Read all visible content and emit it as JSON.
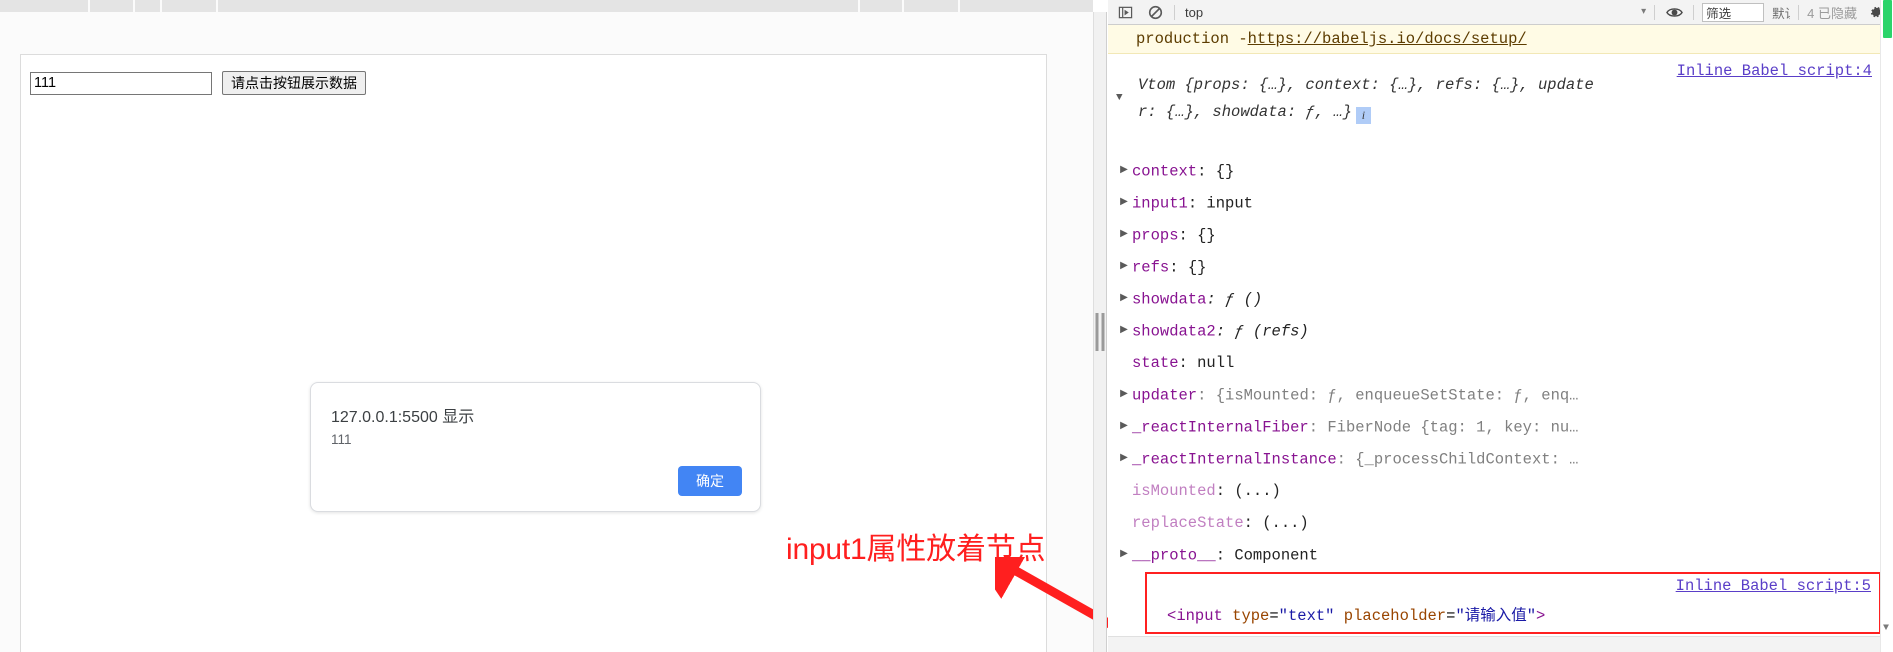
{
  "page": {
    "input": {
      "value": "111",
      "placeholder": "请输入值"
    },
    "show_data_button": "请点击按钮展示数据"
  },
  "dialog": {
    "origin": "127.0.0.1:5500 显示",
    "message": "111",
    "ok_button": "确定"
  },
  "annotation": {
    "text": "input1属性放着节点",
    "color": "#ff1f1f"
  },
  "devtools": {
    "toolbar": {
      "sidebar_icon": "sidebar-toggle-icon",
      "clear_icon": "clear-console-icon",
      "context": "top",
      "context_caret": "▾",
      "eye_icon": "live-expression-icon",
      "filter_placeholder": "筛选",
      "filter_value": "筛选",
      "levels": "默认级别",
      "hidden_count": "4 已隐藏",
      "settings_icon": "gear-icon"
    },
    "warning": {
      "text": "production - ",
      "link": "https://babeljs.io/docs/setup/"
    },
    "log_entry": {
      "source": "Inline Babel script:4",
      "header_line1": "Vtom {props: {…}, context: {…}, refs: {…}, update",
      "header_line2": "r: {…}, showdata: ƒ, …}",
      "info_badge": "i",
      "properties": [
        {
          "arrow": "▶",
          "name": "context",
          "value": ": {}",
          "dim": false
        },
        {
          "arrow": "▶",
          "name": "input1",
          "value": ": input",
          "dim": false
        },
        {
          "arrow": "▶",
          "name": "props",
          "value": ": {}",
          "dim": false
        },
        {
          "arrow": "▶",
          "name": "refs",
          "value": ": {}",
          "dim": false
        },
        {
          "arrow": "▶",
          "name": "showdata",
          "value": ": ƒ ()",
          "dim": false
        },
        {
          "arrow": "▶",
          "name": "showdata2",
          "value": ": ƒ (refs)",
          "dim": false
        },
        {
          "arrow": "",
          "name": "state",
          "value": ": null",
          "dim": false
        },
        {
          "arrow": "▶",
          "name": "updater",
          "value": ": {isMounted: ƒ, enqueueSetState: ƒ, enq…",
          "dim": false
        },
        {
          "arrow": "▶",
          "name": "_reactInternalFiber",
          "value": ": FiberNode {tag: 1, key: nu…",
          "dim": false
        },
        {
          "arrow": "▶",
          "name": "_reactInternalInstance",
          "value": ": {_processChildContext: …",
          "dim": false
        },
        {
          "arrow": "",
          "name": "isMounted",
          "value": ": (...)",
          "dim": true
        },
        {
          "arrow": "",
          "name": "replaceState",
          "value": ": (...)",
          "dim": true
        },
        {
          "arrow": "▶",
          "name": "__proto__",
          "value": ": Component",
          "dim": false
        }
      ]
    },
    "boxed_entry": {
      "source": "Inline Babel script:5",
      "code": {
        "open": "<",
        "tag": "input",
        "attr1_name": "type",
        "attr1_value": "\"text\"",
        "attr2_name": "placeholder",
        "attr2_value": "\"请输入值\"",
        "close": ">"
      }
    }
  }
}
